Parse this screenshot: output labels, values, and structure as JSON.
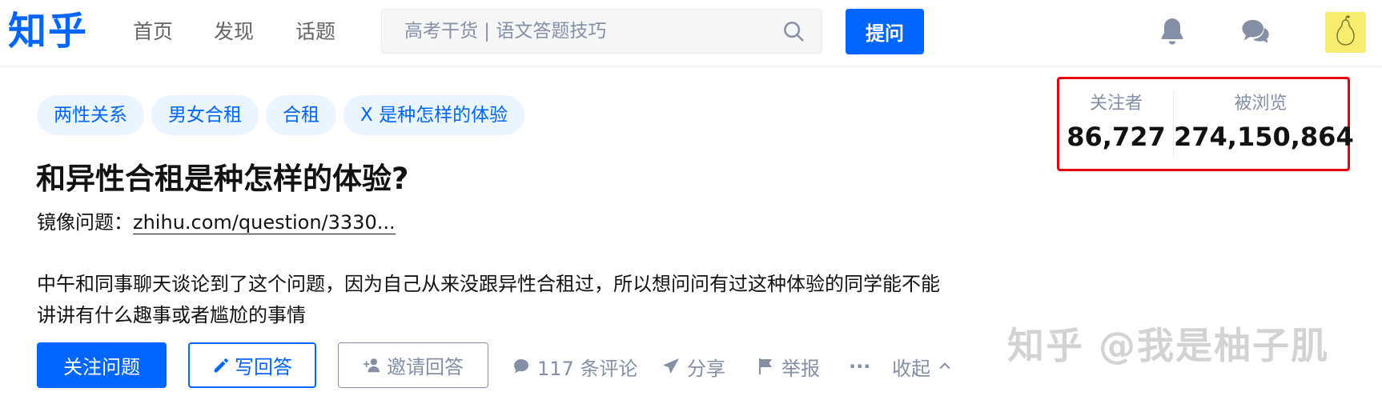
{
  "header": {
    "logo": "知乎",
    "nav": [
      {
        "label": "首页"
      },
      {
        "label": "发现"
      },
      {
        "label": "话题"
      }
    ],
    "search": {
      "placeholder": "高考干货 | 语文答题技巧",
      "icon": "search-icon"
    },
    "ask_label": "提问",
    "icons": {
      "notification": "bell-icon",
      "messages": "chat-bubbles-icon"
    },
    "brand_color": "#0066ff"
  },
  "question": {
    "tags": [
      "两性关系",
      "男女合租",
      "合租",
      "X 是种怎样的体验"
    ],
    "title": "和异性合租是种怎样的体验?",
    "mirror_label": "镜像问题：",
    "mirror_link": "zhihu.com/question/3330...",
    "detail": "中午和同事聊天谈论到了这个问题，因为自己从来没跟异性合租过，所以想问问有过这种体验的同学能不能讲讲有什么趣事或者尴尬的事情"
  },
  "actions": {
    "follow": "关注问题",
    "write": "写回答",
    "invite": "邀请回答",
    "comments": "117 条评论",
    "share": "分享",
    "report": "举报",
    "more": "···",
    "collapse": "收起"
  },
  "stats": {
    "followers_label": "关注者",
    "followers": "86,727",
    "views_label": "被浏览",
    "views": "274,150,864",
    "highlight_color": "#e8000b"
  },
  "watermark": "知乎 @我是柚子肌"
}
